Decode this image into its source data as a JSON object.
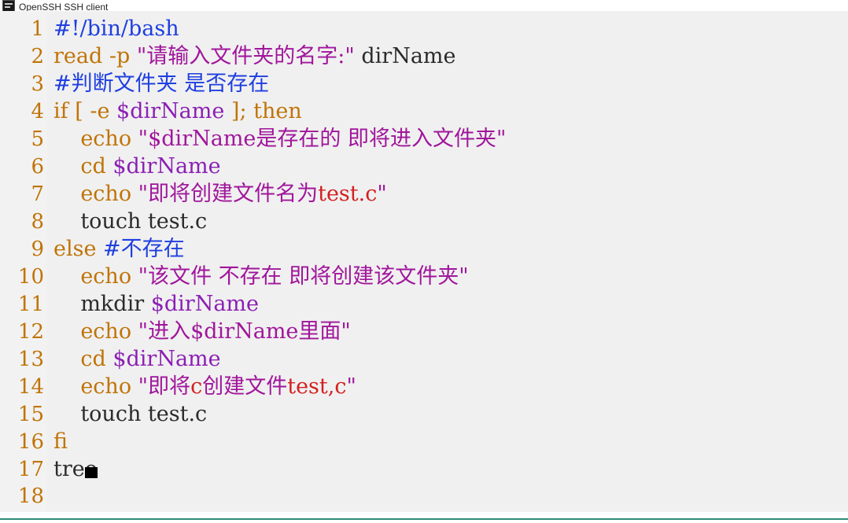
{
  "window": {
    "title": "OpenSSH SSH client",
    "icon": "terminal-icon"
  },
  "editor": {
    "type": "vim",
    "filetype": "sh",
    "empty_line_marker": "~",
    "cursor": {
      "line": 17,
      "column": 5
    },
    "colors": {
      "background": "#f0f0f0",
      "gutter": "#f2f2f2",
      "line_number": "#c07408",
      "keyword": "#c07408",
      "string": "#a0169b",
      "variable": "#8b1fb4",
      "comment": "#1f3fe0",
      "plain": "#2b2b2b",
      "error": "#d32020",
      "bottom_rule": "#2e8b78",
      "cursor": "#000000"
    },
    "lines": [
      {
        "number": "1",
        "tokens": [
          {
            "text": "#!/bin/bash",
            "cls": "tok-com"
          }
        ]
      },
      {
        "number": "2",
        "tokens": [
          {
            "text": "read -p ",
            "cls": "tok-kw"
          },
          {
            "text": "\"请输入文件夹的名字:\"",
            "cls": "tok-str"
          },
          {
            "text": " dirName",
            "cls": "tok-plain"
          }
        ]
      },
      {
        "number": "3",
        "tokens": [
          {
            "text": "#判断文件夹 是否存在",
            "cls": "tok-com"
          }
        ]
      },
      {
        "number": "4",
        "tokens": [
          {
            "text": "if [ -e ",
            "cls": "tok-kw"
          },
          {
            "text": "$dirName",
            "cls": "tok-var"
          },
          {
            "text": " ]; then",
            "cls": "tok-kw"
          }
        ]
      },
      {
        "number": "5",
        "tokens": [
          {
            "text": "    echo ",
            "cls": "tok-kw"
          },
          {
            "text": "\"$dirName是存在的 即将进入文件夹\"",
            "cls": "tok-str"
          }
        ]
      },
      {
        "number": "6",
        "tokens": [
          {
            "text": "    cd ",
            "cls": "tok-kw"
          },
          {
            "text": "$dirName",
            "cls": "tok-var"
          }
        ]
      },
      {
        "number": "7",
        "tokens": [
          {
            "text": "    echo ",
            "cls": "tok-kw"
          },
          {
            "text": "\"即将创建文件名为",
            "cls": "tok-str"
          },
          {
            "text": "test.c",
            "cls": "tok-red"
          },
          {
            "text": "\"",
            "cls": "tok-str"
          }
        ]
      },
      {
        "number": "8",
        "tokens": [
          {
            "text": "    touch test.c",
            "cls": "tok-plain"
          }
        ]
      },
      {
        "number": "9",
        "tokens": [
          {
            "text": "else ",
            "cls": "tok-kw"
          },
          {
            "text": "#不存在",
            "cls": "tok-com"
          }
        ]
      },
      {
        "number": "10",
        "tokens": [
          {
            "text": "    echo ",
            "cls": "tok-kw"
          },
          {
            "text": "\"该文件 不存在 即将创建该文件夹\"",
            "cls": "tok-str"
          }
        ]
      },
      {
        "number": "11",
        "tokens": [
          {
            "text": "    mkdir ",
            "cls": "tok-plain"
          },
          {
            "text": "$dirName",
            "cls": "tok-var"
          }
        ]
      },
      {
        "number": "12",
        "tokens": [
          {
            "text": "    echo ",
            "cls": "tok-kw"
          },
          {
            "text": "\"进入$dirName里面\"",
            "cls": "tok-str"
          }
        ]
      },
      {
        "number": "13",
        "tokens": [
          {
            "text": "    cd ",
            "cls": "tok-kw"
          },
          {
            "text": "$dirName",
            "cls": "tok-var"
          }
        ]
      },
      {
        "number": "14",
        "tokens": [
          {
            "text": "    echo ",
            "cls": "tok-kw"
          },
          {
            "text": "\"即将",
            "cls": "tok-str"
          },
          {
            "text": "c",
            "cls": "tok-red"
          },
          {
            "text": "创建文件",
            "cls": "tok-str"
          },
          {
            "text": "test,c",
            "cls": "tok-red"
          },
          {
            "text": "\"",
            "cls": "tok-str"
          }
        ]
      },
      {
        "number": "15",
        "tokens": [
          {
            "text": "    touch test.c",
            "cls": "tok-plain"
          }
        ]
      },
      {
        "number": "16",
        "tokens": [
          {
            "text": "fi",
            "cls": "tok-kw"
          }
        ]
      },
      {
        "number": "17",
        "tokens": [
          {
            "text": "tree",
            "cls": "tok-plain",
            "cursor_after": true
          }
        ]
      },
      {
        "number": "18",
        "tokens": []
      }
    ]
  }
}
